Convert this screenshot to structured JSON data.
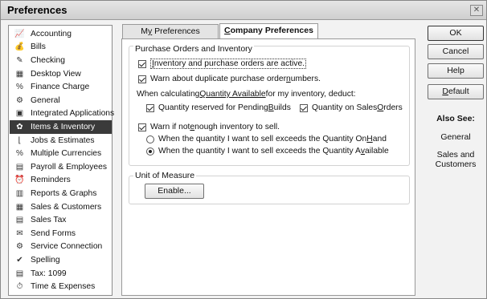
{
  "window": {
    "title": "Preferences",
    "close_label": "✕"
  },
  "sidebar": {
    "items": [
      {
        "label": "Accounting",
        "icon": "📈"
      },
      {
        "label": "Bills",
        "icon": "💰"
      },
      {
        "label": "Checking",
        "icon": "✎"
      },
      {
        "label": "Desktop View",
        "icon": "▦"
      },
      {
        "label": "Finance Charge",
        "icon": "%"
      },
      {
        "label": "General",
        "icon": "⚙"
      },
      {
        "label": "Integrated Applications",
        "icon": "▣"
      },
      {
        "label": "Items & Inventory",
        "icon": "✿"
      },
      {
        "label": "Jobs & Estimates",
        "icon": "⌊"
      },
      {
        "label": "Multiple Currencies",
        "icon": "%"
      },
      {
        "label": "Payroll & Employees",
        "icon": "▤"
      },
      {
        "label": "Reminders",
        "icon": "⏰"
      },
      {
        "label": "Reports & Graphs",
        "icon": "▥"
      },
      {
        "label": "Sales & Customers",
        "icon": "▦"
      },
      {
        "label": "Sales Tax",
        "icon": "▤"
      },
      {
        "label": "Send Forms",
        "icon": "✉"
      },
      {
        "label": "Service Connection",
        "icon": "⚙"
      },
      {
        "label": "Spelling",
        "icon": "✔"
      },
      {
        "label": "Tax: 1099",
        "icon": "▤"
      },
      {
        "label": "Time & Expenses",
        "icon": "⏱"
      }
    ]
  },
  "tabs": {
    "my_prefix": "M",
    "my_u": "y",
    "my_rest": " Preferences",
    "company_u": "C",
    "company_rest": "ompany Preferences"
  },
  "purchase": {
    "title": "Purchase Orders and Inventory",
    "active_u": "I",
    "active_rest": "nventory and purchase orders are active.",
    "warn_dup_a": "Warn about duplicate purchase order ",
    "warn_dup_u": "n",
    "warn_dup_b": "umbers.",
    "calc_a": "When calculating ",
    "calc_link": "Quantity Available",
    "calc_b": " for my inventory, deduct:",
    "pending_a": "Quantity reserved for Pending ",
    "pending_u": "B",
    "pending_b": "uilds",
    "sales_orders_a": "Quantity on Sales ",
    "sales_orders_u": "O",
    "sales_orders_b": "rders",
    "warn_not_a": "Warn if not ",
    "warn_not_u": "e",
    "warn_not_b": "nough inventory to sell.",
    "radio_hand_a": "When the quantity I want to sell exceeds the Quantity On ",
    "radio_hand_u": "H",
    "radio_hand_b": "and",
    "radio_avail_a": "When the quantity I want to sell exceeds the Quantity A",
    "radio_avail_u": "v",
    "radio_avail_b": "ailable"
  },
  "uom": {
    "title": "Unit of Measure",
    "enable_label": "Enable..."
  },
  "buttons": {
    "ok": "OK",
    "cancel": "Cancel",
    "help": "Help",
    "default_u": "D",
    "default_rest": "efault"
  },
  "also_see": {
    "title": "Also See:",
    "links": [
      "General",
      "Sales and Customers"
    ]
  }
}
